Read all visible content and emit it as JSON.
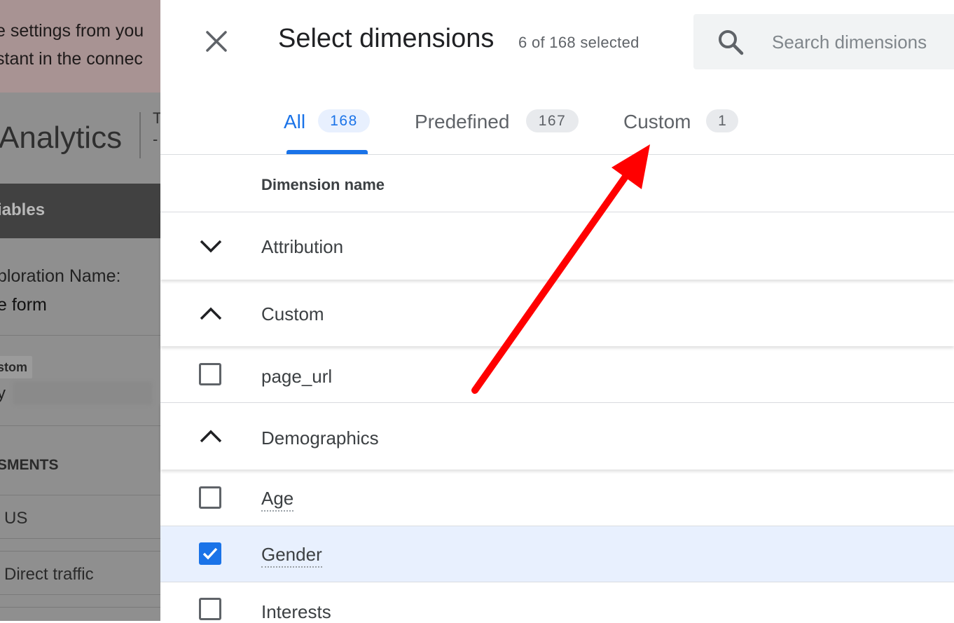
{
  "background": {
    "banner_lines": [
      "e settings from you",
      "stant in the connec"
    ],
    "logo": "Analytics",
    "header_char": "T",
    "variables_label": "iables",
    "exploration_label": "ploration Name:",
    "exploration_value": "e form",
    "chip_label": "stom",
    "chip_sub": "y",
    "segments_label": "SMENTS",
    "segment_items": [
      "US",
      "Direct traffic"
    ]
  },
  "panel": {
    "title": "Select dimensions",
    "selected_count": "6 of 168 selected",
    "close_icon": "close-icon",
    "search": {
      "placeholder": "Search dimensions",
      "value": "",
      "icon": "search-icon"
    },
    "tabs": [
      {
        "label": "All",
        "count": "168",
        "active": true
      },
      {
        "label": "Predefined",
        "count": "167",
        "active": false
      },
      {
        "label": "Custom",
        "count": "1",
        "active": false
      }
    ],
    "column_header": "Dimension name",
    "groups": [
      {
        "label": "Attribution",
        "expanded": false
      },
      {
        "label": "Custom",
        "expanded": true,
        "items": [
          {
            "label": "page_url",
            "checked": false
          }
        ]
      },
      {
        "label": "Demographics",
        "expanded": true,
        "items": [
          {
            "label": "Age",
            "checked": false
          },
          {
            "label": "Gender",
            "checked": true
          },
          {
            "label": "Interests",
            "checked": false
          }
        ]
      }
    ]
  },
  "colors": {
    "accent": "#1a73e8",
    "annotation_arrow": "#ff0000",
    "selected_row": "#e8f0fe",
    "overlay_dim": "#8f8f8f"
  }
}
